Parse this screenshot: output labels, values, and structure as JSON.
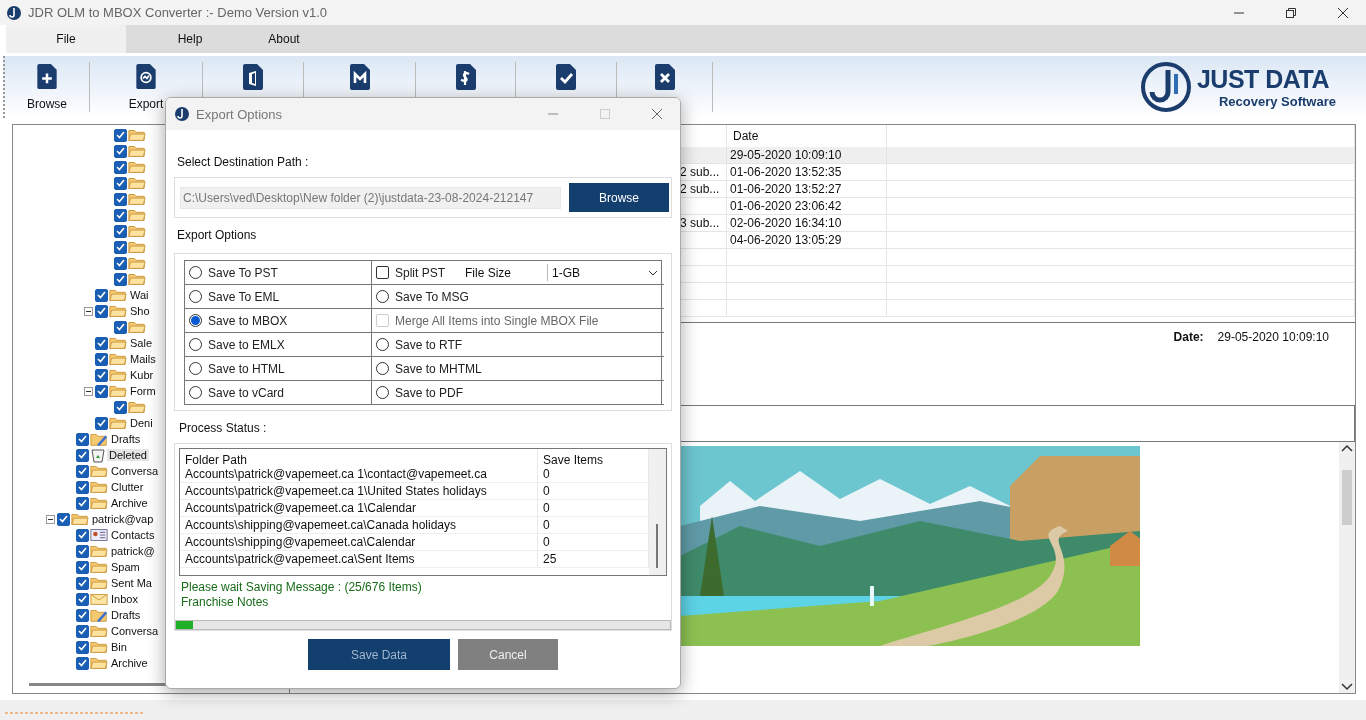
{
  "window": {
    "title": "JDR OLM to MBOX Converter :- Demo Version v1.0"
  },
  "menu": [
    {
      "label": "File",
      "selected": true
    },
    {
      "label": "Help",
      "selected": false
    },
    {
      "label": "About",
      "selected": false
    }
  ],
  "toolbar": [
    {
      "label": "Browse",
      "kind": "plus"
    },
    {
      "label": "Export",
      "kind": "sync"
    },
    {
      "kind": "office"
    },
    {
      "kind": "mail"
    },
    {
      "kind": "dollar"
    },
    {
      "kind": "check"
    },
    {
      "kind": "cross"
    }
  ],
  "logo": {
    "title": "JUST DATA",
    "subtitle": "Recovery Software"
  },
  "tree": [
    {
      "children": [
        {
          "children": [
            {
              "children": [
                {
                  "kind": "folder",
                  "checked": true,
                  "selected": false
                },
                {
                  "kind": "folder",
                  "checked": true,
                  "selected": false
                },
                {
                  "kind": "folder",
                  "checked": true,
                  "selected": false
                },
                {
                  "kind": "folder",
                  "checked": true,
                  "selected": false
                },
                {
                  "kind": "folder",
                  "checked": true,
                  "selected": false
                },
                {
                  "kind": "folder",
                  "checked": true,
                  "selected": false
                },
                {
                  "kind": "folder",
                  "checked": true,
                  "selected": false
                },
                {
                  "kind": "folder",
                  "checked": true,
                  "selected": false
                },
                {
                  "kind": "folder",
                  "checked": true,
                  "selected": false
                },
                {
                  "kind": "folder",
                  "checked": true,
                  "selected": false
                }
              ]
            },
            {
              "label": "Wai",
              "kind": "folder",
              "checked": true,
              "selected": false
            },
            {
              "label": "Sho",
              "kind": "folder",
              "checked": true,
              "selected": false,
              "expanded": true,
              "children": [
                {
                  "kind": "folder",
                  "checked": true,
                  "selected": false
                }
              ]
            },
            {
              "label": "Sale",
              "kind": "folder",
              "checked": true,
              "selected": false
            },
            {
              "label": "Mails",
              "kind": "folder",
              "checked": true,
              "selected": false
            },
            {
              "label": "Kubr",
              "kind": "folder",
              "checked": true,
              "selected": false
            },
            {
              "label": "Form",
              "kind": "folder",
              "checked": true,
              "selected": false,
              "expanded": true,
              "children": [
                {
                  "kind": "folder",
                  "checked": true,
                  "selected": false
                }
              ]
            },
            {
              "label": "Deni",
              "kind": "folder",
              "checked": true,
              "selected": false
            }
          ]
        },
        {
          "label": "Drafts",
          "kind": "drafts",
          "checked": true,
          "selected": false
        },
        {
          "label": "Deleted",
          "kind": "trash",
          "checked": true,
          "selected": true
        },
        {
          "label": "Conversa",
          "kind": "folder",
          "checked": true,
          "selected": false
        },
        {
          "label": "Clutter",
          "kind": "folder",
          "checked": true,
          "selected": false
        },
        {
          "label": "Archive",
          "kind": "folder",
          "checked": true,
          "selected": false
        }
      ]
    },
    {
      "label": "patrick@vap",
      "kind": "folder",
      "checked": true,
      "selected": false,
      "expanded": true,
      "children": [
        {
          "label": "Contacts",
          "kind": "contacts",
          "checked": true,
          "selected": false
        },
        {
          "label": "patrick@",
          "kind": "folder",
          "checked": true,
          "selected": false
        },
        {
          "label": "Spam",
          "kind": "folder",
          "checked": true,
          "selected": false
        },
        {
          "label": "Sent Ma",
          "kind": "folder",
          "checked": true,
          "selected": false
        },
        {
          "label": "Inbox",
          "kind": "inbox",
          "checked": true,
          "selected": false
        },
        {
          "label": "Drafts",
          "kind": "drafts",
          "checked": true,
          "selected": false
        },
        {
          "label": "Conversa",
          "kind": "folder",
          "checked": true,
          "selected": false
        },
        {
          "label": "Bin",
          "kind": "folder",
          "checked": true,
          "selected": false
        },
        {
          "label": "Archive",
          "kind": "folder",
          "checked": true,
          "selected": false
        }
      ]
    }
  ],
  "mail_list": {
    "columns": [
      "Date"
    ],
    "rows": [
      {
        "column_2": "",
        "date": "29-05-2020 10:09:10",
        "selected": true
      },
      {
        "column_2": "2 sub...",
        "date": "01-06-2020 13:52:35",
        "selected": false
      },
      {
        "column_2": "2 sub...",
        "date": "01-06-2020 13:52:27",
        "selected": false
      },
      {
        "column_2": "",
        "date": "01-06-2020 23:06:42",
        "selected": false
      },
      {
        "column_2": "3 sub...",
        "date": "02-06-2020 16:34:10",
        "selected": false
      },
      {
        "column_2": "",
        "date": "04-06-2020 13:05:29",
        "selected": false
      }
    ]
  },
  "preview": {
    "date_label": "Date:",
    "date_value": "29-05-2020 10:09:10"
  },
  "dialog": {
    "title": "Export Options",
    "path_label": "Select Destination Path :",
    "path_value": "C:\\Users\\ved\\Desktop\\New folder (2)\\justdata-23-08-2024-212147",
    "browse": "Browse",
    "options_label": "Export Options",
    "options": [
      [
        {
          "kind": "radio",
          "label": "Save To PST",
          "selected": false
        },
        {
          "kind": "split",
          "label": "Split PST",
          "checked": false,
          "size_label": "File Size",
          "size_value": "1-GB"
        }
      ],
      [
        {
          "kind": "radio",
          "label": "Save To EML",
          "selected": false
        },
        {
          "kind": "radio",
          "label": "Save To MSG",
          "selected": false
        }
      ],
      [
        {
          "kind": "radio",
          "label": "Save to MBOX",
          "selected": true
        },
        {
          "kind": "checkbox",
          "label": "Merge All Items into Single MBOX File",
          "checked": false,
          "disabled": true
        }
      ],
      [
        {
          "kind": "radio",
          "label": "Save to EMLX",
          "selected": false
        },
        {
          "kind": "radio",
          "label": "Save to RTF",
          "selected": false
        }
      ],
      [
        {
          "kind": "radio",
          "label": "Save to HTML",
          "selected": false
        },
        {
          "kind": "radio",
          "label": "Save to MHTML",
          "selected": false
        }
      ],
      [
        {
          "kind": "radio",
          "label": "Save to vCard",
          "selected": false
        },
        {
          "kind": "radio",
          "label": "Save to PDF",
          "selected": false
        }
      ]
    ],
    "status_label": "Process Status :",
    "status_table": {
      "columns": [
        "Folder Path",
        "Save Items"
      ],
      "rows": [
        [
          "Accounts\\patrick@vapemeet.ca 1\\contact@vapemeet.ca",
          "0"
        ],
        [
          "Accounts\\patrick@vapemeet.ca 1\\United States holidays",
          "0"
        ],
        [
          "Accounts\\patrick@vapemeet.ca 1\\Calendar",
          "0"
        ],
        [
          "Accounts\\shipping@vapemeet.ca\\Canada holidays",
          "0"
        ],
        [
          "Accounts\\shipping@vapemeet.ca\\Calendar",
          "0"
        ],
        [
          "Accounts\\patrick@vapemeet.ca\\Sent Items",
          "25"
        ]
      ]
    },
    "messages": [
      "Please wait Saving Message : (25/676 Items)",
      "Franchise Notes"
    ],
    "progress": {
      "level": 0.035
    },
    "buttons": [
      {
        "label": "Save Data",
        "kind": "primary"
      },
      {
        "label": "Cancel",
        "kind": "secondary"
      }
    ]
  }
}
